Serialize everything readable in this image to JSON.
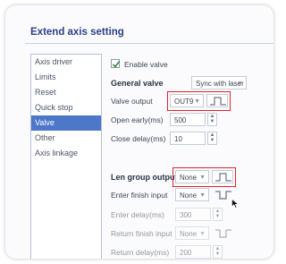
{
  "window": {
    "title": "Extend axis setting"
  },
  "sidebar": {
    "items": [
      {
        "label": "Axis driver"
      },
      {
        "label": "Limits"
      },
      {
        "label": "Reset"
      },
      {
        "label": "Quick stop"
      },
      {
        "label": "Valve",
        "active": true
      },
      {
        "label": "Other"
      },
      {
        "label": "Axis linkage"
      }
    ]
  },
  "valve": {
    "enable_label": "Enable valve",
    "enable_checked": true,
    "general_valve_label": "General valve",
    "general_valve_value": "Sync with laser",
    "valve_output_label": "Valve output",
    "valve_output_value": "OUT9",
    "open_early_label": "Open early(ms)",
    "open_early_value": "500",
    "close_delay_label": "Close delay(ms)",
    "close_delay_value": "10"
  },
  "len_group": {
    "output_label": "Len group output",
    "output_value": "None",
    "enter_finish_label": "Enter finish input",
    "enter_finish_value": "None",
    "enter_delay_label": "Enter delay(ms)",
    "enter_delay_value": "300",
    "return_finish_label": "Return finish input",
    "return_finish_value": "None",
    "return_delay_label": "Return delay(ms)",
    "return_delay_value": "200"
  },
  "colors": {
    "accent": "#4d78c9",
    "title": "#28418a",
    "highlight": "#e0242e"
  }
}
